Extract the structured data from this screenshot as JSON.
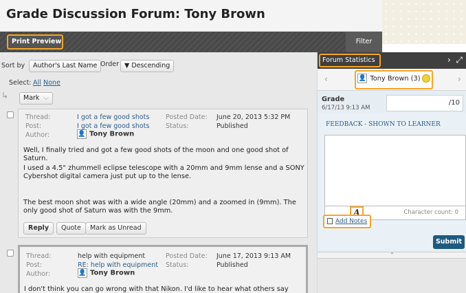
{
  "header": {
    "title": "Grade Discussion Forum: Tony Brown"
  },
  "toolbar": {
    "print_preview": "Print Preview",
    "filter": "Filter"
  },
  "sort": {
    "sort_by_label": "Sort by",
    "sort_by_value": "Author's Last Name",
    "order_label": "Order",
    "order_value": "▼ Descending",
    "select_label": "Select:",
    "select_all": "All",
    "select_none": "None",
    "mark_label": "Mark"
  },
  "posts": [
    {
      "thread_label": "Thread:",
      "thread": "I got a few good shots",
      "post_label": "Post:",
      "post": "I got a few good shots",
      "author_label": "Author:",
      "author": "Tony Brown",
      "posted_label": "Posted Date:",
      "posted": "June 20, 2013 5:32 PM",
      "status_label": "Status:",
      "status": "Published",
      "paragraphs": [
        "Well, I finally tried and got a few good shots of the moon and one good shot of Saturn.",
        "I used a 4.5\" zhummell eclipse telescope with a 20mm and 9mm lense and a SONY Cybershot digital camera just put up to the lense.",
        "The best moon shot was with a wide angle (20mm) and a zoomed in (9mm). The only good shot of Saturn was with the 9mm."
      ],
      "actions": {
        "reply": "Reply",
        "quote": "Quote",
        "mark_unread": "Mark as Unread"
      }
    },
    {
      "thread_label": "Thread:",
      "thread": "help with equipment",
      "post_label": "Post:",
      "post": "RE: help with equipment",
      "author_label": "Author:",
      "author": "Tony Brown",
      "posted_label": "Posted Date:",
      "posted": "June 17, 2013 9:13 AM",
      "status_label": "Status:",
      "status": "Published",
      "paragraphs": [
        "I don't think you can go wrong with that Nikon. I'd like to hear what others say about"
      ]
    }
  ],
  "panel": {
    "forum_stats": "Forum Statistics ⌄",
    "user": "Tony Brown (3)",
    "grade_label": "Grade",
    "grade_date": "6/17/13 9:13 AM",
    "grade_max": "/10",
    "feedback_label": "FEEDBACK - SHOWN TO LEARNER",
    "char_count": "Character count: 0",
    "add_notes": "Add Notes",
    "submit": "Submit"
  },
  "colors": {
    "accent_highlight": "#f5a623",
    "submit": "#1e5a80",
    "link": "#2b5c8a",
    "toolbar": "#4b4b4b"
  }
}
